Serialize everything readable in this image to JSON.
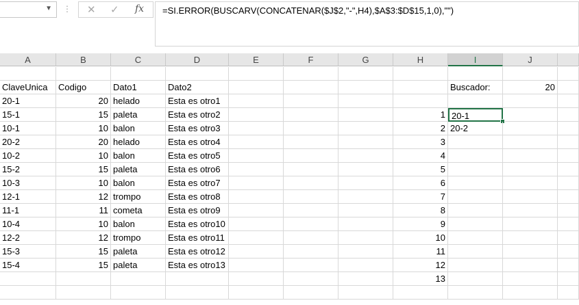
{
  "formula_bar": {
    "name_box_value": "",
    "cancel_icon": "✕",
    "enter_icon": "✓",
    "fx_label": "fx",
    "formula": "=SI.ERROR(BUSCARV(CONCATENAR($J$2,\"-\",H4),$A$3:$D$15,1,0),\"\")"
  },
  "columns": [
    "A",
    "B",
    "C",
    "D",
    "E",
    "F",
    "G",
    "H",
    "I",
    "J"
  ],
  "selected_column": "I",
  "table_headers": [
    "ClaveUnica",
    "Codigo",
    "Dato1",
    "Dato2"
  ],
  "table_rows": [
    [
      "20-1",
      "20",
      "helado",
      "Esta es otro1"
    ],
    [
      "15-1",
      "15",
      "paleta",
      "Esta es otro2"
    ],
    [
      "10-1",
      "10",
      "balon",
      "Esta es otro3"
    ],
    [
      "20-2",
      "20",
      "helado",
      "Esta es otro4"
    ],
    [
      "10-2",
      "10",
      "balon",
      "Esta es otro5"
    ],
    [
      "15-2",
      "15",
      "paleta",
      "Esta es otro6"
    ],
    [
      "10-3",
      "10",
      "balon",
      "Esta es otro7"
    ],
    [
      "12-1",
      "12",
      "trompo",
      "Esta es otro8"
    ],
    [
      "11-1",
      "11",
      "cometa",
      "Esta es otro9"
    ],
    [
      "10-4",
      "10",
      "balon",
      "Esta es otro10"
    ],
    [
      "12-2",
      "12",
      "trompo",
      "Esta es otro11"
    ],
    [
      "15-3",
      "15",
      "paleta",
      "Esta es otro12"
    ],
    [
      "15-4",
      "15",
      "paleta",
      "Esta es otro13"
    ]
  ],
  "buscador_label": "Buscador:",
  "buscador_value": "20",
  "index_numbers": [
    "1",
    "2",
    "3",
    "4",
    "5",
    "6",
    "7",
    "8",
    "9",
    "10",
    "11",
    "12",
    "13"
  ],
  "results": [
    "20-1",
    "20-2"
  ]
}
